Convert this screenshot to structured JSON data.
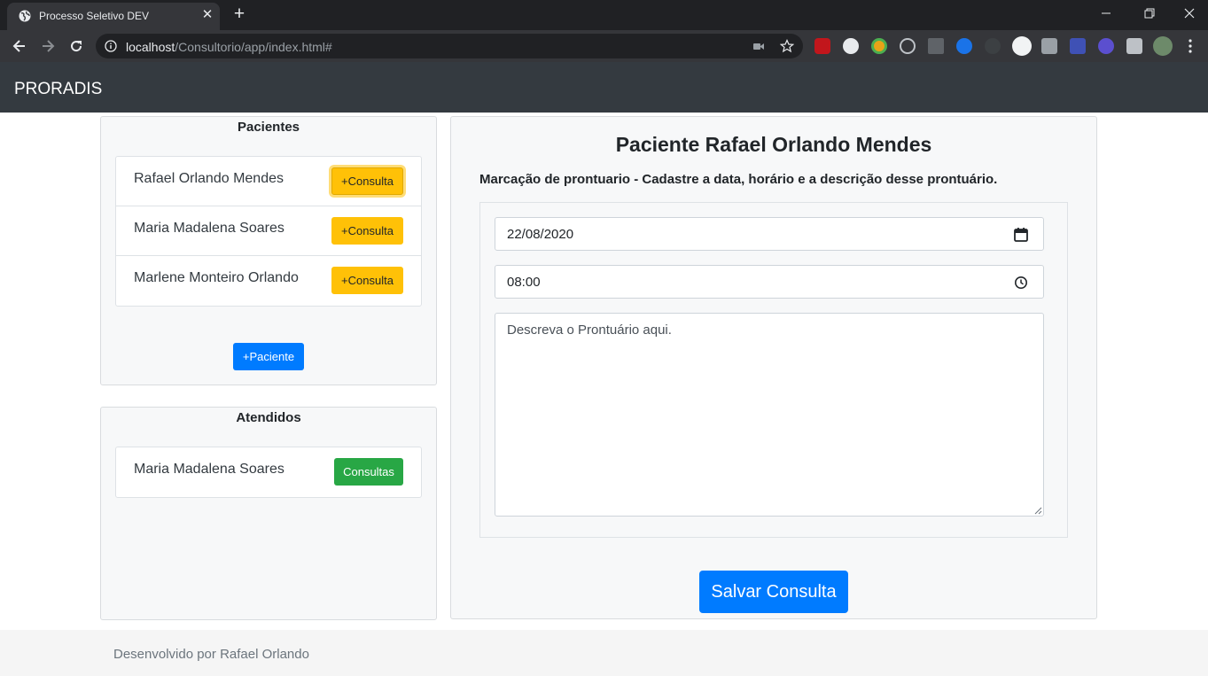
{
  "browser": {
    "tab_title": "Processo Seletivo DEV",
    "tab_close": "✕",
    "new_tab": "+",
    "url_host": "localhost",
    "url_path": "/Consultorio/app/index.html#"
  },
  "app": {
    "brand": "PRORADIS"
  },
  "patients_card": {
    "title": "Pacientes",
    "patients": [
      {
        "name": "Rafael Orlando Mendes",
        "action": "+Consulta"
      },
      {
        "name": "Maria Madalena Soares",
        "action": "+Consulta"
      },
      {
        "name": "Marlene Monteiro Orlando",
        "action": "+Consulta"
      }
    ],
    "add_patient_label": "+Paciente"
  },
  "attended_card": {
    "title": "Atendidos",
    "patients": [
      {
        "name": "Maria Madalena Soares",
        "action": "Consultas"
      }
    ]
  },
  "appointment": {
    "heading": "Paciente Rafael Orlando Mendes",
    "subtitle": "Marcação de prontuario - Cadastre a data, horário e a descrição desse prontuário.",
    "date_value": "22/08/2020",
    "time_value": "08:00",
    "description_placeholder": "Descreva o Prontuário aqui.",
    "save_label": "Salvar Consulta"
  },
  "footer": {
    "text": "Desenvolvido por Rafael Orlando"
  },
  "colors": {
    "navbar": "#343a40",
    "primary": "#007bff",
    "warning": "#ffc107",
    "success": "#28a745"
  }
}
